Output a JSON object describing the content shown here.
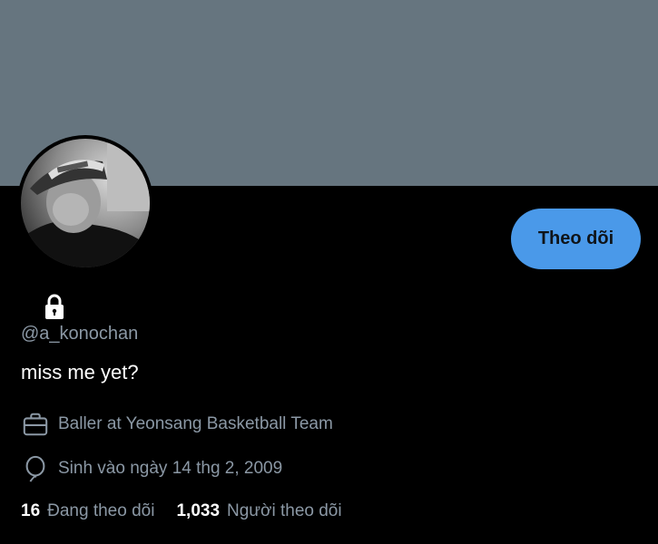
{
  "profile": {
    "follow_button_label": "Theo dõi",
    "handle": "@a_konochan",
    "bio": "miss me yet?",
    "job": "Baller at Yeonsang Basketball Team",
    "birthday": "Sinh vào ngày 14 thg 2, 2009",
    "following_count": "16",
    "following_label": "Đang theo dõi",
    "followers_count": "1,033",
    "followers_label": "Người theo dõi"
  },
  "icons": {
    "lock": "lock-icon",
    "briefcase": "briefcase-icon",
    "balloon": "balloon-icon"
  },
  "colors": {
    "banner": "#66757f",
    "background": "#000000",
    "accent": "#4a99e9",
    "secondary_text": "#8b98a5"
  }
}
